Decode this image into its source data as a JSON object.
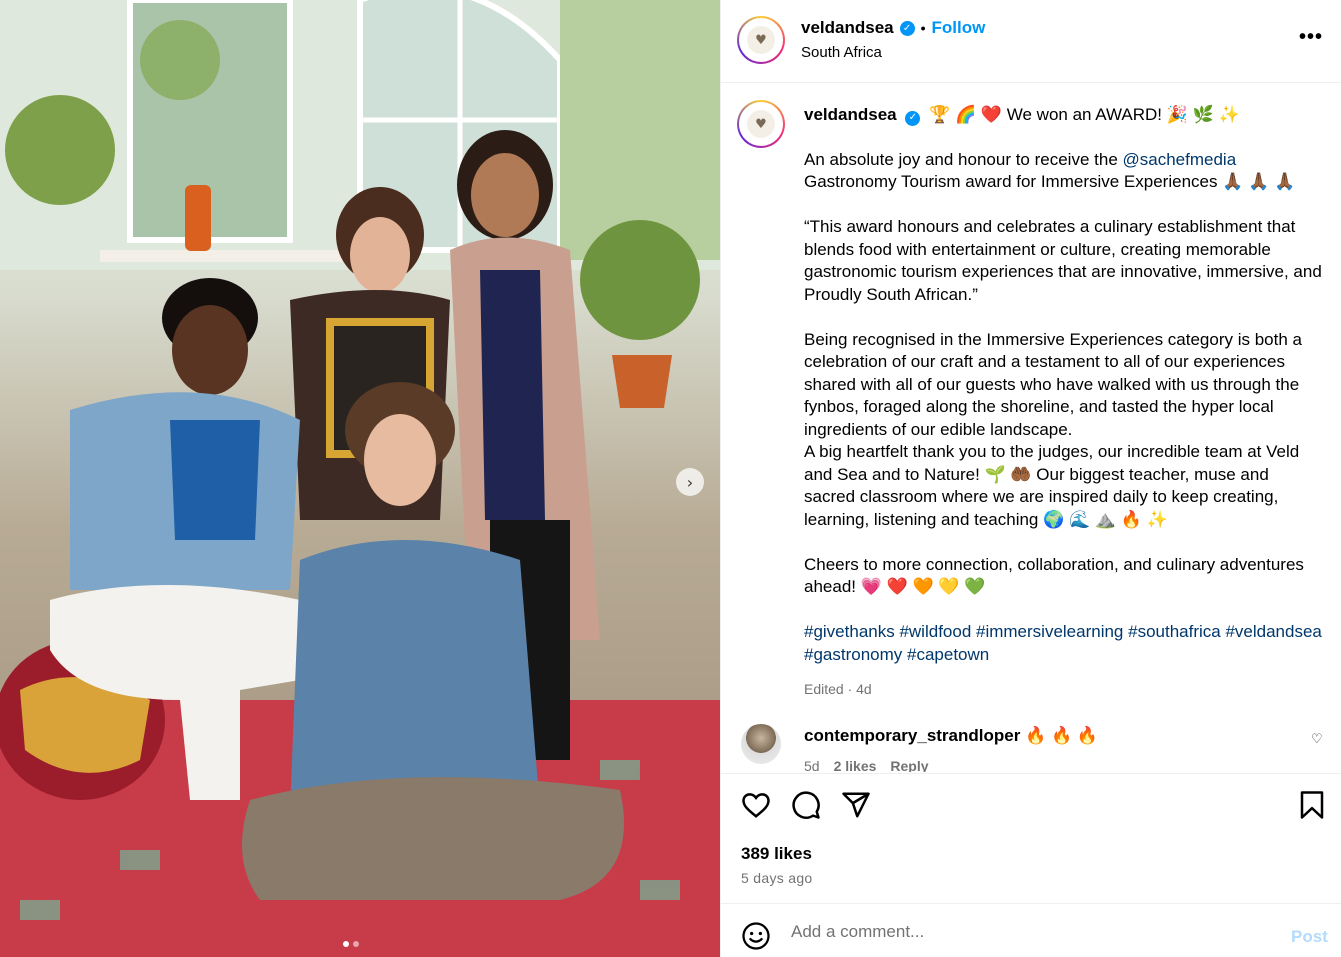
{
  "post": {
    "username": "veldandsea",
    "follow_label": "Follow",
    "separator": "•",
    "location": "South Africa",
    "more_label": "•••",
    "carousel_next": "›"
  },
  "caption": {
    "username": "veldandsea",
    "line1": "🏆 🌈 ❤️ We won an AWARD! 🎉 🌿 ✨",
    "p1_before": "An absolute joy and honour to receive the ",
    "p1_mention": "@sachefmedia",
    "p1_after": " Gastronomy Tourism award for Immersive Experiences 🙏🏾 🙏🏾 🙏🏾",
    "p2": "“This award honours and celebrates a culinary establishment that blends food with entertainment or culture, creating memorable gastronomic tourism experiences that are innovative, immersive, and Proudly South African.”",
    "p3": "Being recognised in the Immersive Experiences category is both a celebration of our craft and a testament to all of our experiences shared with all of our guests who have walked with us through the fynbos, foraged along the shoreline, and tasted the hyper local ingredients of our edible landscape.",
    "p4": "A big heartfelt thank you to the judges, our incredible team at Veld and Sea and to Nature! 🌱 🤲🏾 Our biggest teacher, muse and sacred classroom where we are inspired daily to keep creating, learning, listening and teaching 🌍 🌊 ⛰️ 🔥 ✨",
    "p5": "Cheers to more connection, collaboration, and culinary adventures ahead! 💗 ❤️ 🧡 💛 💚",
    "hashtags": "#givethanks #wildfood #immersivelearning #southafrica #veldandsea #gastronomy #capetown",
    "meta": "Edited · 4d"
  },
  "comment": {
    "username": "contemporary_strandloper",
    "text": " 🔥 🔥 🔥",
    "age": "5d",
    "likes": "2 likes",
    "reply": "Reply"
  },
  "stats": {
    "likes": "389 likes",
    "time_ago": "5 days ago"
  },
  "add_comment": {
    "placeholder": "Add a comment...",
    "post_label": "Post"
  },
  "colors": {
    "link_blue": "#0095f6",
    "hashtag": "#00376b",
    "muted": "#737373",
    "post_disabled": "#b3dbff"
  },
  "icons": [
    "verified-icon",
    "more-options-icon",
    "heart-icon",
    "comment-icon",
    "share-icon",
    "save-icon",
    "emoji-icon",
    "small-heart-icon",
    "chevron-right-icon"
  ]
}
